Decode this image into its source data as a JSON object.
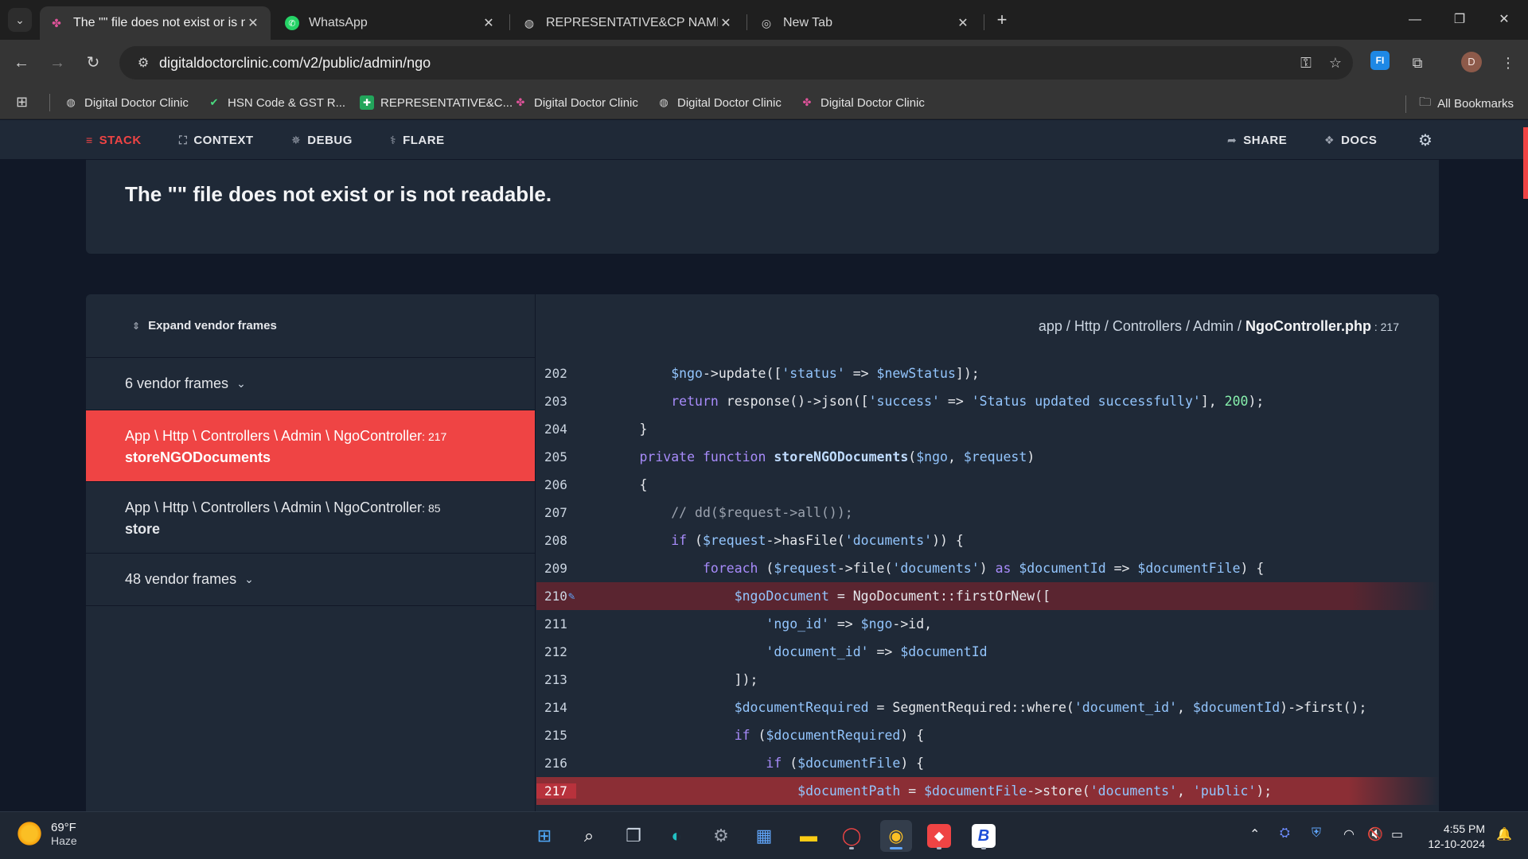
{
  "browser": {
    "tabs": [
      {
        "title": "The \"\" file does not exist or is n",
        "favicon": "flare-icon",
        "active": true
      },
      {
        "title": "WhatsApp",
        "favicon": "whatsapp-icon",
        "active": false
      },
      {
        "title": "REPRESENTATIVE&CP NAME",
        "favicon": "globe-icon",
        "active": false
      },
      {
        "title": "New Tab",
        "favicon": "chrome-icon",
        "active": false
      }
    ],
    "url": "digitaldoctorclinic.com/v2/public/admin/ngo",
    "avatar_letter": "D",
    "extension_label": "FI",
    "bookmarks": [
      {
        "label": "Digital Doctor Clinic",
        "icon": "globe-icon"
      },
      {
        "label": "HSN Code & GST R...",
        "icon": "check-icon"
      },
      {
        "label": "REPRESENTATIVE&C...",
        "icon": "sheets-icon"
      },
      {
        "label": "Digital Doctor Clinic",
        "icon": "flare-icon"
      },
      {
        "label": "Digital Doctor Clinic",
        "icon": "globe-icon"
      },
      {
        "label": "Digital Doctor Clinic",
        "icon": "flare-icon"
      }
    ],
    "all_bookmarks_label": "All Bookmarks"
  },
  "ignition": {
    "nav": {
      "stack": "STACK",
      "context": "CONTEXT",
      "debug": "DEBUG",
      "flare": "FLARE",
      "share": "SHARE",
      "docs": "DOCS"
    },
    "error_message": "The \"\" file does not exist or is not readable.",
    "expand_vendor_label": "Expand vendor frames",
    "vendor_frames_top": "6 vendor frames",
    "vendor_frames_bottom": "48 vendor frames",
    "frames": [
      {
        "class": "App \\ Http \\ Controllers \\ Admin \\ NgoController",
        "line": ": 217",
        "method": "storeNGODocuments",
        "selected": true
      },
      {
        "class": "App \\ Http \\ Controllers \\ Admin \\ NgoController",
        "line": ": 85",
        "method": "store",
        "selected": false
      }
    ],
    "file_path": {
      "dirs": "app / Http / Controllers / Admin / ",
      "file": "NgoController.php",
      "line": " : 217"
    },
    "code": {
      "line_numbers": [
        "202",
        "203",
        "204",
        "205",
        "206",
        "207",
        "208",
        "209",
        "210",
        "211",
        "212",
        "213",
        "214",
        "215",
        "216",
        "217"
      ]
    },
    "accent_color": "#ef4444"
  },
  "taskbar": {
    "temperature": "69°F",
    "condition": "Haze",
    "time": "4:55 PM",
    "date": "12-10-2024"
  }
}
